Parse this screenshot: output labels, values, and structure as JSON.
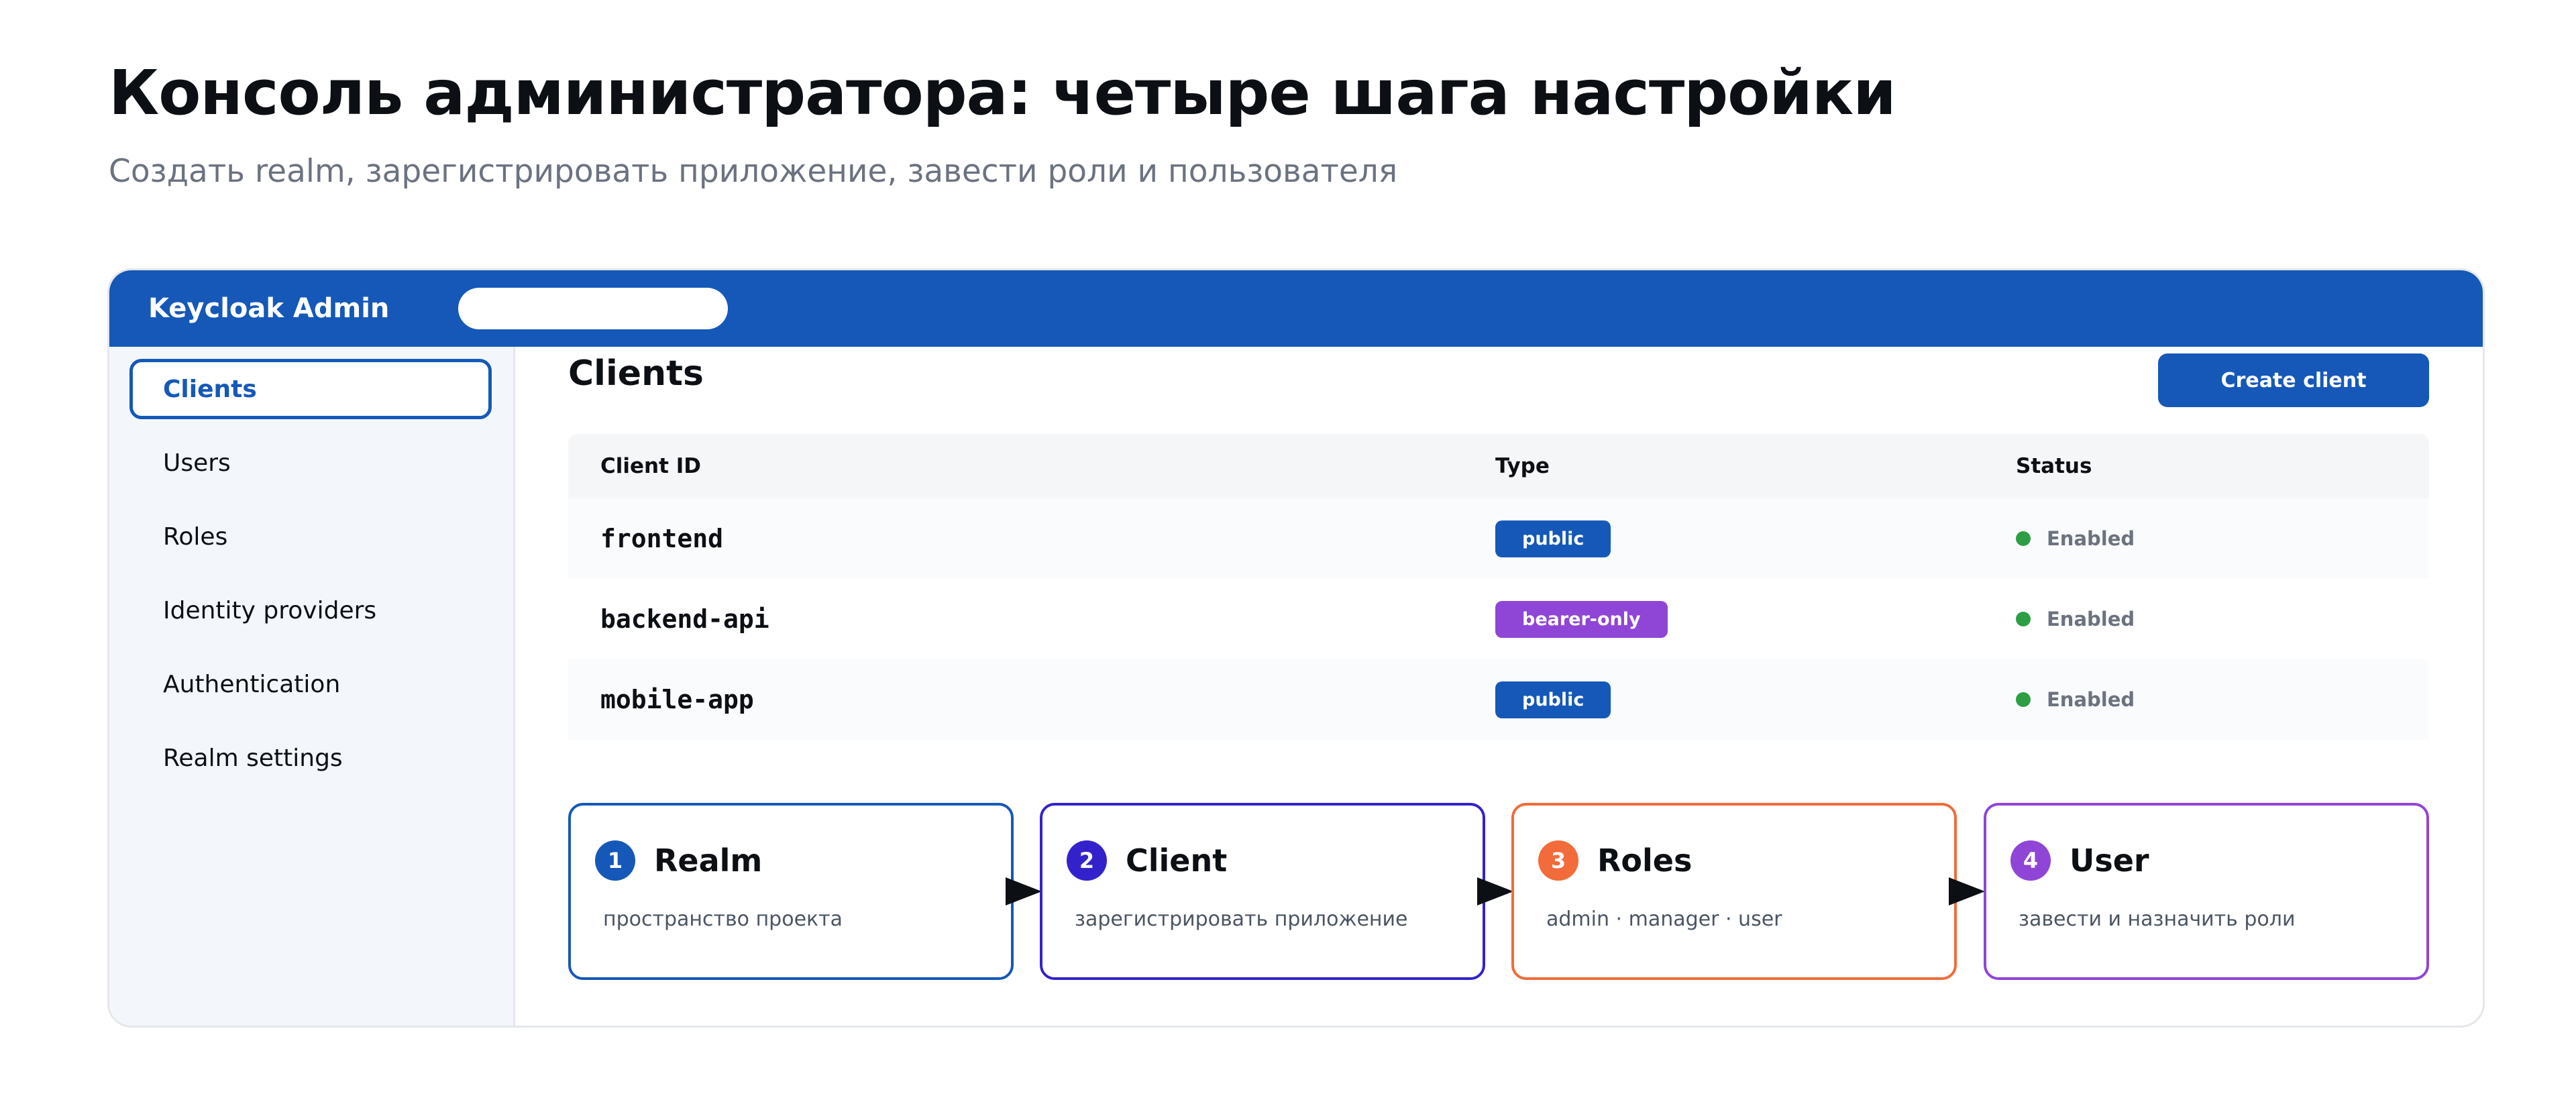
{
  "page": {
    "title": "Консоль администратора: четыре шага настройки",
    "subtitle": "Создать realm, зарегистрировать приложение, завести роли и пользователя"
  },
  "app": {
    "brand": "Keycloak Admin",
    "search": {
      "value": "",
      "placeholder": ""
    }
  },
  "sidebar": {
    "items": [
      {
        "label": "Clients",
        "active": true
      },
      {
        "label": "Users",
        "active": false
      },
      {
        "label": "Roles",
        "active": false
      },
      {
        "label": "Identity providers",
        "active": false
      },
      {
        "label": "Authentication",
        "active": false
      },
      {
        "label": "Realm settings",
        "active": false
      }
    ]
  },
  "main": {
    "title": "Clients",
    "create_label": "Create client"
  },
  "table": {
    "columns": [
      "Client ID",
      "Type",
      "Status"
    ],
    "rows": [
      {
        "client_id": "frontend",
        "type": "public",
        "status": "Enabled"
      },
      {
        "client_id": "backend-api",
        "type": "bearer-only",
        "status": "Enabled"
      },
      {
        "client_id": "mobile-app",
        "type": "public",
        "status": "Enabled"
      }
    ]
  },
  "steps": [
    {
      "num": "1",
      "title": "Realm",
      "desc": "пространство проекта"
    },
    {
      "num": "2",
      "title": "Client",
      "desc": "зарегистрировать приложение"
    },
    {
      "num": "3",
      "title": "Roles",
      "desc": "admin · manager · user"
    },
    {
      "num": "4",
      "title": "User",
      "desc": "завести и назначить роли"
    }
  ],
  "colors": {
    "primary": "#1558b8",
    "public_badge": "#1558b8",
    "bearer_badge": "#8f45d6",
    "status_enabled": "#2e9e44",
    "step1": "#1558b8",
    "step2": "#3322cc",
    "step3": "#f26b3a",
    "step4": "#8f45d6"
  }
}
